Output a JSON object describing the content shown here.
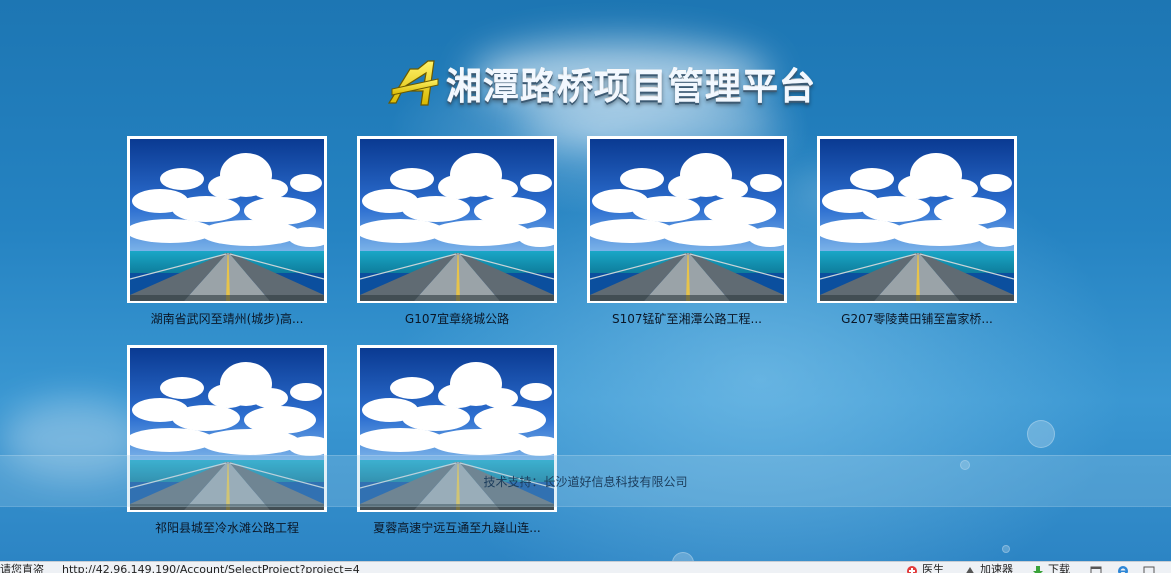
{
  "header": {
    "title": "湘潭路桥项目管理平台"
  },
  "projects": [
    {
      "name": "湖南省武冈至靖州(城步)高..."
    },
    {
      "name": "G107宜章绕城公路"
    },
    {
      "name": "S107锰矿至湘潭公路工程..."
    },
    {
      "name": "G207零陵黄田铺至富家桥..."
    },
    {
      "name": "祁阳县城至冷水滩公路工程"
    },
    {
      "name": "夏蓉高速宁远互通至九嶷山连..."
    }
  ],
  "footer": {
    "support": "技术支持：长沙道好信息科技有限公司"
  },
  "statusbar": {
    "left_text": "请您直盗",
    "url": "http://42.96.149.190/Account/SelectProject?project=4",
    "right_items": [
      "医生",
      "加速器",
      "下载"
    ]
  },
  "colors": {
    "background": "#2583c2",
    "card_border": "#ffffff",
    "caption_text": "#0a1626"
  }
}
